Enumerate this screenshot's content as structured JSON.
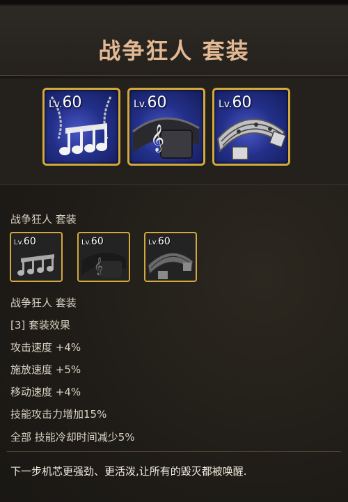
{
  "set": {
    "title": "战争狂人 套装",
    "items": [
      {
        "level_prefix": "Lv.",
        "level": "60",
        "icon": "music-notes-necklace-icon"
      },
      {
        "level_prefix": "Lv.",
        "level": "60",
        "icon": "treble-clef-ring-icon"
      },
      {
        "level_prefix": "Lv.",
        "level": "60",
        "icon": "music-staff-bracelet-icon"
      }
    ]
  },
  "detail": {
    "set_name": "战争狂人 套装",
    "items": [
      {
        "level_prefix": "Lv.",
        "level": "60"
      },
      {
        "level_prefix": "Lv.",
        "level": "60"
      },
      {
        "level_prefix": "Lv.",
        "level": "60"
      }
    ],
    "bonus_name": "战争狂人 套装",
    "bonus_header": "[3] 套装效果",
    "stats": [
      "攻击速度 +4%",
      "施放速度 +5%",
      "移动速度 +4%",
      "技能攻击力增加15%",
      "全部 技能冷却时间减少5%"
    ],
    "flavor_text": "下一步机芯更强劲、更活泼,让所有的毁灭都被唤醒."
  },
  "colors": {
    "title": "#e2b994",
    "item_border": "#d4a93c",
    "text": "#d8d2c4"
  }
}
